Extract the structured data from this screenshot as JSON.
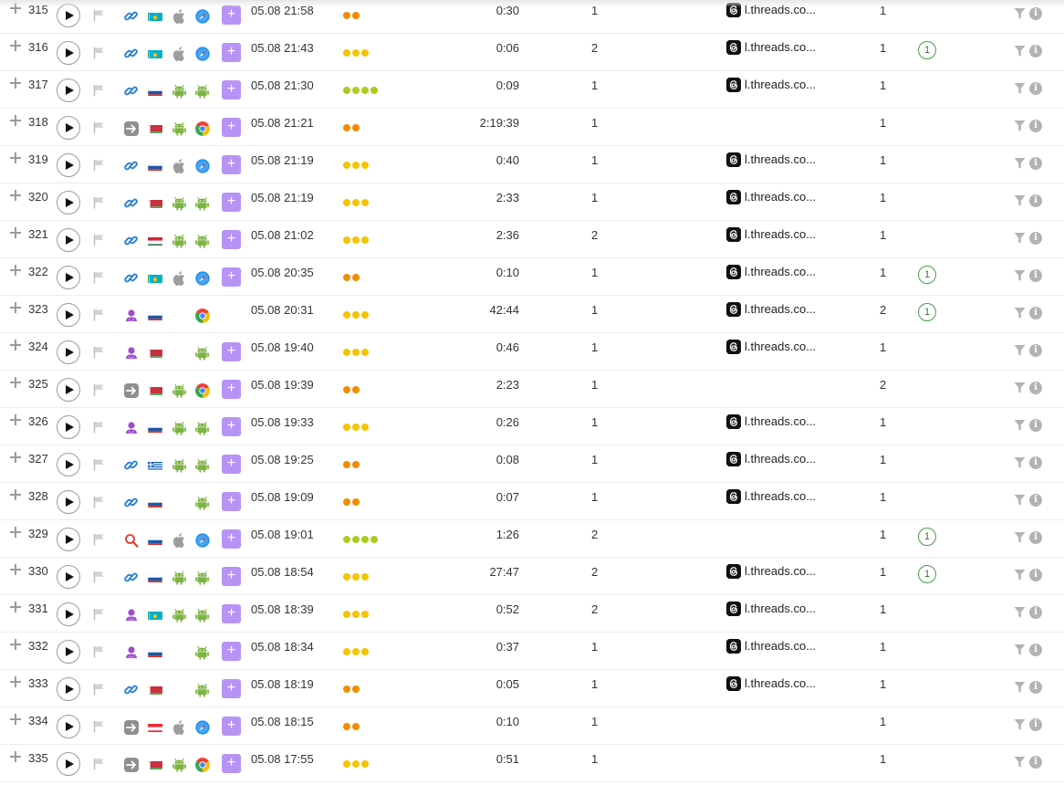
{
  "colors": {
    "dot_orange": "#f28c00",
    "dot_yellow": "#f5c400",
    "dot_lime": "#aacc22",
    "add_button": "#b794f4",
    "visit_badge_border": "#43a047"
  },
  "rows": [
    {
      "num": "315",
      "source": "link-icon",
      "country": "kz",
      "os": "apple-icon",
      "browser": "safari-icon",
      "add": true,
      "date": "05.08 21:58",
      "dots": "orange",
      "dot_count": 2,
      "duration": "0:30",
      "pages": "1",
      "referrer": "l.threads.co...",
      "visits": "1",
      "badge": ""
    },
    {
      "num": "316",
      "source": "link-icon",
      "country": "kz",
      "os": "apple-icon",
      "browser": "safari-icon",
      "add": true,
      "date": "05.08 21:43",
      "dots": "yellow",
      "dot_count": 3,
      "duration": "0:06",
      "pages": "2",
      "referrer": "l.threads.co...",
      "visits": "1",
      "badge": "1"
    },
    {
      "num": "317",
      "source": "link-icon",
      "country": "ru",
      "os": "android-icon",
      "browser": "android-icon",
      "add": true,
      "date": "05.08 21:30",
      "dots": "lime",
      "dot_count": 4,
      "duration": "0:09",
      "pages": "1",
      "referrer": "l.threads.co...",
      "visits": "1",
      "badge": ""
    },
    {
      "num": "318",
      "source": "direct-icon",
      "country": "by",
      "os": "android-icon",
      "browser": "chrome-icon",
      "add": true,
      "date": "05.08 21:21",
      "dots": "orange",
      "dot_count": 2,
      "duration": "2:19:39",
      "pages": "1",
      "referrer": "",
      "visits": "1",
      "badge": ""
    },
    {
      "num": "319",
      "source": "link-icon",
      "country": "ru",
      "os": "apple-icon",
      "browser": "safari-icon",
      "add": true,
      "date": "05.08 21:19",
      "dots": "yellow",
      "dot_count": 3,
      "duration": "0:40",
      "pages": "1",
      "referrer": "l.threads.co...",
      "visits": "1",
      "badge": ""
    },
    {
      "num": "320",
      "source": "link-icon",
      "country": "by",
      "os": "android-icon",
      "browser": "android-icon",
      "add": true,
      "date": "05.08 21:19",
      "dots": "yellow",
      "dot_count": 3,
      "duration": "2:33",
      "pages": "1",
      "referrer": "l.threads.co...",
      "visits": "1",
      "badge": ""
    },
    {
      "num": "321",
      "source": "link-icon",
      "country": "hu",
      "os": "android-icon",
      "browser": "android-icon",
      "add": true,
      "date": "05.08 21:02",
      "dots": "yellow",
      "dot_count": 3,
      "duration": "2:36",
      "pages": "2",
      "referrer": "l.threads.co...",
      "visits": "1",
      "badge": ""
    },
    {
      "num": "322",
      "source": "link-icon",
      "country": "kz",
      "os": "apple-icon",
      "browser": "safari-icon",
      "add": true,
      "date": "05.08 20:35",
      "dots": "orange",
      "dot_count": 2,
      "duration": "0:10",
      "pages": "1",
      "referrer": "l.threads.co...",
      "visits": "1",
      "badge": "1"
    },
    {
      "num": "323",
      "source": "social-icon",
      "country": "ru",
      "os": "",
      "browser": "chrome-icon",
      "add": false,
      "date": "05.08 20:31",
      "dots": "yellow",
      "dot_count": 3,
      "duration": "42:44",
      "pages": "1",
      "referrer": "l.threads.co...",
      "visits": "2",
      "badge": "1"
    },
    {
      "num": "324",
      "source": "social-icon",
      "country": "by",
      "os": "",
      "browser": "android-icon",
      "add": true,
      "date": "05.08 19:40",
      "dots": "yellow",
      "dot_count": 3,
      "duration": "0:46",
      "pages": "1",
      "referrer": "l.threads.co...",
      "visits": "1",
      "badge": ""
    },
    {
      "num": "325",
      "source": "direct-icon",
      "country": "by",
      "os": "android-icon",
      "browser": "chrome-icon",
      "add": true,
      "date": "05.08 19:39",
      "dots": "orange",
      "dot_count": 2,
      "duration": "2:23",
      "pages": "1",
      "referrer": "",
      "visits": "2",
      "badge": ""
    },
    {
      "num": "326",
      "source": "social-icon",
      "country": "ru",
      "os": "android-icon",
      "browser": "android-icon",
      "add": true,
      "date": "05.08 19:33",
      "dots": "yellow",
      "dot_count": 3,
      "duration": "0:26",
      "pages": "1",
      "referrer": "l.threads.co...",
      "visits": "1",
      "badge": ""
    },
    {
      "num": "327",
      "source": "link-icon",
      "country": "gr",
      "os": "android-icon",
      "browser": "android-icon",
      "add": true,
      "date": "05.08 19:25",
      "dots": "orange",
      "dot_count": 2,
      "duration": "0:08",
      "pages": "1",
      "referrer": "l.threads.co...",
      "visits": "1",
      "badge": ""
    },
    {
      "num": "328",
      "source": "link-icon",
      "country": "ru",
      "os": "",
      "browser": "android-icon",
      "add": true,
      "date": "05.08 19:09",
      "dots": "orange",
      "dot_count": 2,
      "duration": "0:07",
      "pages": "1",
      "referrer": "l.threads.co...",
      "visits": "1",
      "badge": ""
    },
    {
      "num": "329",
      "source": "search-icon",
      "country": "ru",
      "os": "apple-icon",
      "browser": "safari-icon",
      "add": true,
      "date": "05.08 19:01",
      "dots": "lime",
      "dot_count": 4,
      "duration": "1:26",
      "pages": "2",
      "referrer": "",
      "visits": "1",
      "badge": "1"
    },
    {
      "num": "330",
      "source": "link-icon",
      "country": "ru",
      "os": "android-icon",
      "browser": "android-icon",
      "add": true,
      "date": "05.08 18:54",
      "dots": "yellow",
      "dot_count": 3,
      "duration": "27:47",
      "pages": "2",
      "referrer": "l.threads.co...",
      "visits": "1",
      "badge": "1"
    },
    {
      "num": "331",
      "source": "social-icon",
      "country": "kz",
      "os": "android-icon",
      "browser": "android-icon",
      "add": true,
      "date": "05.08 18:39",
      "dots": "yellow",
      "dot_count": 3,
      "duration": "0:52",
      "pages": "2",
      "referrer": "l.threads.co...",
      "visits": "1",
      "badge": ""
    },
    {
      "num": "332",
      "source": "social-icon",
      "country": "ru",
      "os": "",
      "browser": "android-icon",
      "add": true,
      "date": "05.08 18:34",
      "dots": "yellow",
      "dot_count": 3,
      "duration": "0:37",
      "pages": "1",
      "referrer": "l.threads.co...",
      "visits": "1",
      "badge": ""
    },
    {
      "num": "333",
      "source": "link-icon",
      "country": "by",
      "os": "",
      "browser": "android-icon",
      "add": true,
      "date": "05.08 18:19",
      "dots": "orange",
      "dot_count": 2,
      "duration": "0:05",
      "pages": "1",
      "referrer": "l.threads.co...",
      "visits": "1",
      "badge": ""
    },
    {
      "num": "334",
      "source": "direct-icon",
      "country": "at",
      "os": "apple-icon",
      "browser": "safari-icon",
      "add": true,
      "date": "05.08 18:15",
      "dots": "orange",
      "dot_count": 2,
      "duration": "0:10",
      "pages": "1",
      "referrer": "",
      "visits": "1",
      "badge": ""
    },
    {
      "num": "335",
      "source": "direct-icon",
      "country": "by",
      "os": "android-icon",
      "browser": "chrome-icon",
      "add": true,
      "date": "05.08 17:55",
      "dots": "yellow",
      "dot_count": 3,
      "duration": "0:51",
      "pages": "1",
      "referrer": "",
      "visits": "1",
      "badge": ""
    }
  ]
}
